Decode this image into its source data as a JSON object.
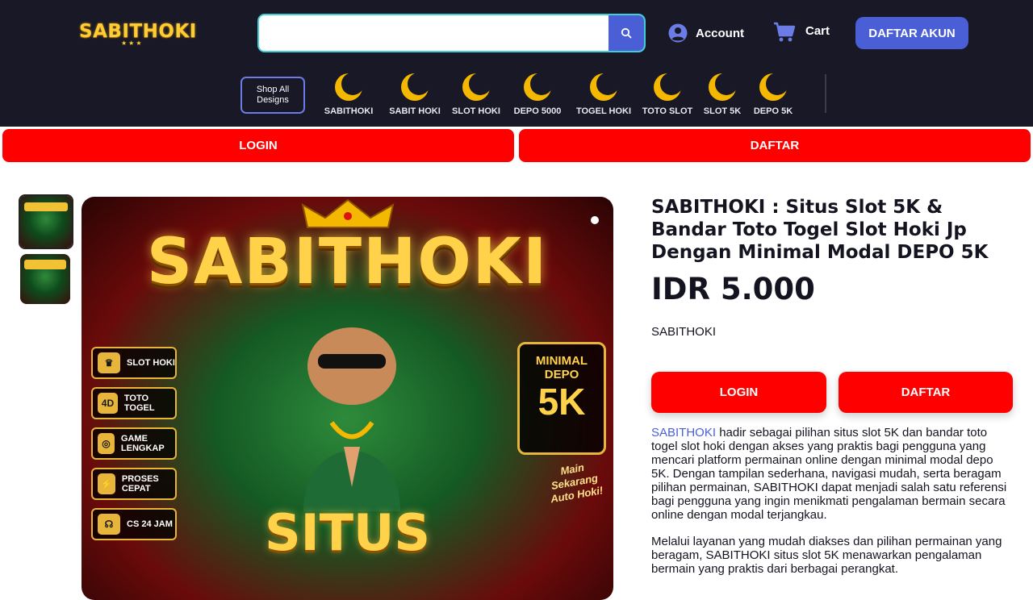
{
  "header": {
    "logo_text": "SABITHOKI",
    "search_placeholder": "",
    "account_label": "Account",
    "cart_label": "Cart",
    "daftar_akun_label": "DAFTAR AKUN",
    "shop_all_label": "Shop All Designs",
    "categories": [
      {
        "label": "SABITHOKI"
      },
      {
        "label": "SABIT HOKI"
      },
      {
        "label": "SLOT HOKI"
      },
      {
        "label": "DEPO 5000"
      },
      {
        "label": "TOGEL HOKI"
      },
      {
        "label": "TOTO SLOT"
      },
      {
        "label": "SLOT 5K"
      },
      {
        "label": "DEPO 5K"
      }
    ]
  },
  "topbar": {
    "login_label": "LOGIN",
    "daftar_label": "DAFTAR"
  },
  "hero": {
    "title": "SABITHOKI",
    "features": [
      {
        "label": "SLOT HOKI"
      },
      {
        "label": "TOTO TOGEL"
      },
      {
        "label": "GAME LENGKAP"
      },
      {
        "label": "PROSES CEPAT"
      },
      {
        "label": "CS 24 JAM"
      }
    ],
    "minimal_label": "MINIMAL DEPO",
    "minimal_value": "5K",
    "note": "Main Sekarang Auto Hoki!",
    "bottom_text": "SITUS"
  },
  "product": {
    "title": "SABITHOKI : Situs Slot 5K & Bandar Toto Togel Slot Hoki Jp Dengan Minimal Modal DEPO 5K",
    "price": "IDR 5.000",
    "brand": "SABITHOKI",
    "login_label": "LOGIN",
    "daftar_label": "DAFTAR",
    "desc_link": "SABITHOKI",
    "desc_p1_rest": " hadir sebagai pilihan situs slot 5K dan bandar toto togel slot hoki dengan akses yang praktis bagi pengguna yang mencari platform permainan online dengan minimal modal depo 5K. Dengan tampilan sederhana, navigasi mudah, serta beragam pilihan permainan, SABITHOKI dapat menjadi salah satu referensi bagi pengguna yang ingin menikmati pengalaman bermain secara online dengan modal terjangkau.",
    "desc_p2": "Melalui layanan yang mudah diakses dan pilihan permainan yang beragam, SABITHOKI situs slot 5K menawarkan pengalaman bermain yang praktis dari berbagai perangkat."
  },
  "colors": {
    "header_bg": "#181826",
    "accent_blue": "#4a5fd6",
    "accent_red": "#ff0000",
    "search_border": "#3ed0d4"
  }
}
